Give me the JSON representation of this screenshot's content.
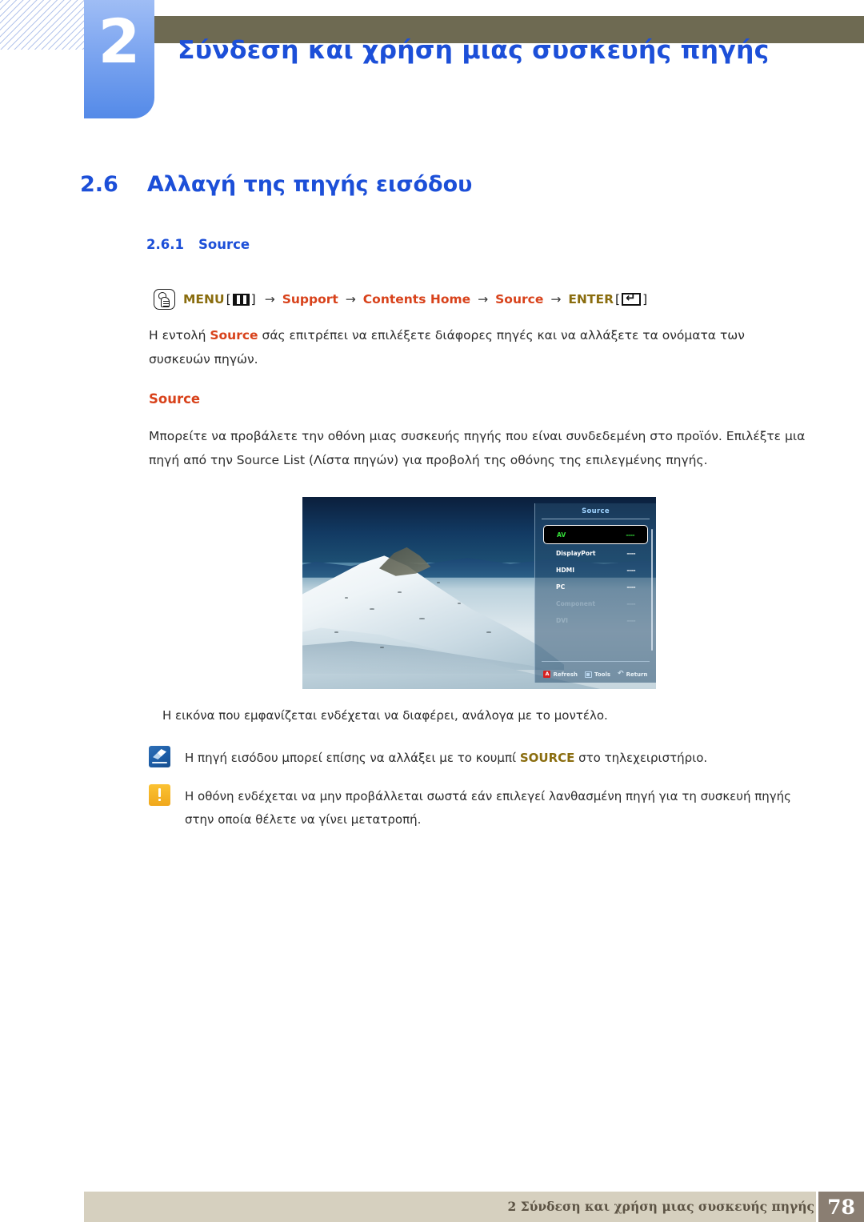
{
  "header": {
    "chapter_number": "2",
    "chapter_title": "Σύνδεση και χρήση μιας συσκευής πηγής"
  },
  "sections": {
    "h2_number": "2.6",
    "h2_title": "Αλλαγή της πηγής εισόδου",
    "h3_number": "2.6.1",
    "h3_title": "Source"
  },
  "menu_path": {
    "touch_icon": "touch-hand-icon",
    "menu_label": "MENU",
    "menu_key_icon": "menu-bars-icon",
    "arrow": "→",
    "step_support": "Support",
    "step_contents_home": "Contents Home",
    "step_source": "Source",
    "enter_label": "ENTER",
    "enter_key_icon": "enter-return-icon",
    "bracket_open": "[",
    "bracket_close": "]"
  },
  "body": {
    "intro_before": "Η εντολή ",
    "intro_bold": "Source",
    "intro_after": " σάς επιτρέπει να επιλέξετε διάφορες πηγές και να αλλάξετε τα ονόματα των συσκευών πηγών.",
    "sub_heading": "Source",
    "paragraph": "Μπορείτε να προβάλετε την οθόνη μιας συσκευής πηγής που είναι συνδεδεμένη στο προϊόν. Επιλέξτε μια πηγή από την Source List (Λίστα πηγών) για προβολή της οθόνης της επιλεγμένης πηγής.",
    "caption": "Η εικόνα που εμφανίζεται ενδέχεται να διαφέρει, ανάλογα με το μοντέλο."
  },
  "osd": {
    "title": "Source",
    "items": [
      {
        "label": "AV",
        "value": "----",
        "state": "selected"
      },
      {
        "label": "DisplayPort",
        "value": "----",
        "state": "normal"
      },
      {
        "label": "HDMI",
        "value": "----",
        "state": "normal"
      },
      {
        "label": "PC",
        "value": "----",
        "state": "normal"
      },
      {
        "label": "Component",
        "value": "----",
        "state": "dim"
      },
      {
        "label": "DVI",
        "value": "----",
        "state": "dim"
      }
    ],
    "footer": [
      {
        "icon": "badge-a-icon",
        "badge": "A",
        "label": "Refresh"
      },
      {
        "icon": "tools-icon",
        "badge": "",
        "label": "Tools"
      },
      {
        "icon": "return-arrow-icon",
        "badge": "",
        "label": "Return"
      }
    ],
    "colors": {
      "selected_text": "#35e03a",
      "title_text": "#9fd3ff",
      "badge_red": "#d81f1f"
    }
  },
  "notes": [
    {
      "icon": "note-pencil-icon",
      "text_before": "Η πηγή εισόδου μπορεί επίσης να αλλάξει με το κουμπί ",
      "highlight": "SOURCE",
      "text_after": " στο τηλεχειριστήριο."
    },
    {
      "icon": "warning-exclamation-icon",
      "text_before": "Η οθόνη ενδέχεται να μην προβάλλεται σωστά εάν επιλεγεί λανθασμένη πηγή για τη συσκευή πηγής στην οποία θέλετε να γίνει μετατροπή.",
      "highlight": "",
      "text_after": ""
    }
  ],
  "footer": {
    "text": "2 Σύνδεση και χρήση μιας συσκευής πηγής",
    "page_number": "78"
  },
  "colors": {
    "heading_blue": "#1c4fd8",
    "accent_orange": "#d8421b",
    "accent_gold": "#8a6d0f",
    "olive_bar": "#6e6a52",
    "footer_bar": "#d6d0bf",
    "footer_page_box": "#8a7e72"
  }
}
